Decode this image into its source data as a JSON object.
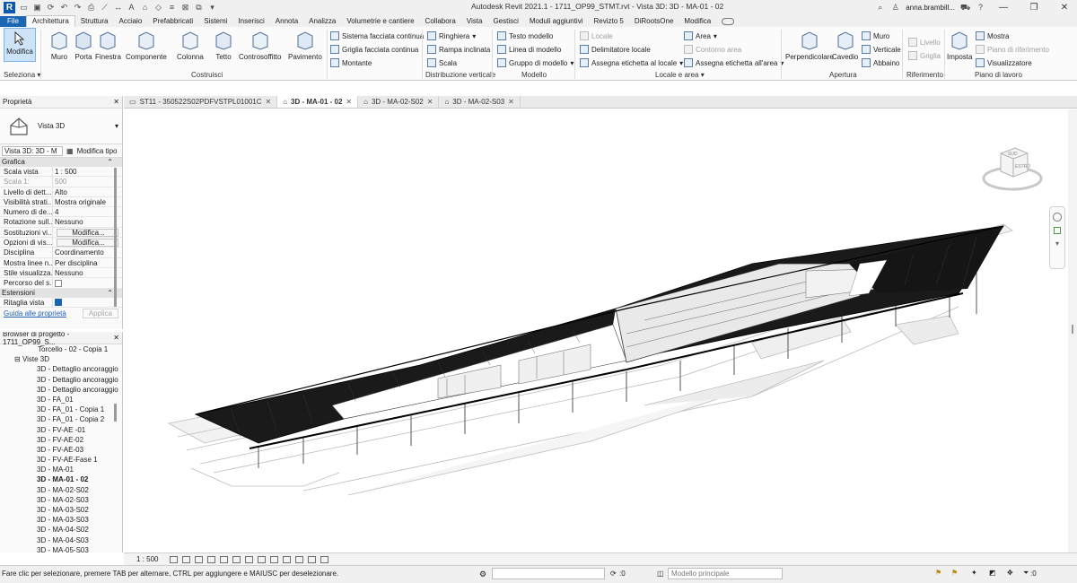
{
  "titlebar": {
    "title": "Autodesk Revit 2021.1 - 1711_OP99_STMT.rvt - Vista 3D: 3D - MA-01 - 02",
    "user": "anna.brambill...",
    "logo_letter": "R",
    "text_tool": "A"
  },
  "ribbon_tabs": [
    "File",
    "Architettura",
    "Struttura",
    "Acciaio",
    "Prefabbricati",
    "Sistemi",
    "Inserisci",
    "Annota",
    "Analizza",
    "Volumetrie e cantiere",
    "Collabora",
    "Vista",
    "Gestisci",
    "Moduli aggiuntivi",
    "Revizto 5",
    "DiRootsOne",
    "Modifica"
  ],
  "ribbon": {
    "modify": "Modifica",
    "build": [
      "Muro",
      "Porta",
      "Finestra",
      "Componente",
      "Colonna",
      "Tetto",
      "Controsoffitto",
      "Pavimento"
    ],
    "curtain": [
      "Sistema facciata continua",
      "Griglia facciata continua",
      "Montante"
    ],
    "circulation": [
      "Ringhiera",
      "Rampa inclinata",
      "Scala"
    ],
    "model": [
      "Testo modello",
      "Linea di modello",
      "Gruppo di modello"
    ],
    "room": [
      "Locale",
      "Delimitatore  locale",
      "Assegna etichetta  al locale"
    ],
    "area": [
      "Area",
      "Contorno  area",
      "Assegna etichetta  all'area"
    ],
    "opening": [
      "Perpendicolare",
      "Cavedio"
    ],
    "opening_small": [
      "Muro",
      "Verticale",
      "Abbaino"
    ],
    "datum": [
      "Livello",
      "Griglia"
    ],
    "workplane_big": "Imposta",
    "workplane": [
      "Mostra",
      "Piano di riferimento",
      "Visualizzatore"
    ],
    "panels": {
      "select": "Seleziona",
      "build": "Costruisci",
      "circulation": "Distribuzione verticale",
      "model": "Modello",
      "room": "Locale e area",
      "opening": "Apertura",
      "datum": "Riferimento",
      "workplane": "Piano di lavoro"
    }
  },
  "properties": {
    "title": "Proprietà",
    "type_name": "Vista 3D",
    "instance": "Vista 3D: 3D - M",
    "edit_type": "Modifica tipo",
    "group_graphics": "Grafica",
    "group_extents": "Estensioni",
    "rows": [
      {
        "k": "Scala vista",
        "v": "1 : 500"
      },
      {
        "k": "Scala  1:",
        "v": "500"
      },
      {
        "k": "Livello di dett...",
        "v": "Alto"
      },
      {
        "k": "Visibilità strati...",
        "v": "Mostra originale"
      },
      {
        "k": "Numero di de...",
        "v": "4"
      },
      {
        "k": "Rotazione sull...",
        "v": "Nessuno"
      },
      {
        "k": "Sostituzioni vi...",
        "v": "Modifica..."
      },
      {
        "k": "Opzioni di vis...",
        "v": "Modifica..."
      },
      {
        "k": "Disciplina",
        "v": "Coordinamento"
      },
      {
        "k": "Mostra linee n...",
        "v": "Per disciplina"
      },
      {
        "k": "Stile visualizza...",
        "v": "Nessuno"
      },
      {
        "k": "Percorso del s...",
        "v": ""
      }
    ],
    "crop": "Ritaglia vista",
    "help": "Guida alle proprietà",
    "apply": "Applica"
  },
  "browser": {
    "title": "Browser di progetto - 1711_OP99_S...",
    "items": [
      {
        "label": "Torcello - 02 - Copia 1",
        "indent": 2
      },
      {
        "label": "Viste 3D",
        "indent": 1
      },
      {
        "label": "3D - Dettaglio ancoraggio",
        "indent": 3
      },
      {
        "label": "3D - Dettaglio ancoraggio",
        "indent": 3
      },
      {
        "label": "3D - Dettaglio ancoraggio",
        "indent": 3
      },
      {
        "label": "3D - FA_01",
        "indent": 3
      },
      {
        "label": "3D - FA_01 - Copia 1",
        "indent": 3
      },
      {
        "label": "3D - FA_01 - Copia 2",
        "indent": 3
      },
      {
        "label": "3D - FV-AE -01",
        "indent": 3
      },
      {
        "label": "3D - FV-AE-02",
        "indent": 3
      },
      {
        "label": "3D - FV-AE-03",
        "indent": 3
      },
      {
        "label": "3D - FV-AE-Fase 1",
        "indent": 3
      },
      {
        "label": "3D - MA-01",
        "indent": 3
      },
      {
        "label": "3D - MA-01 - 02",
        "indent": 3,
        "bold": true
      },
      {
        "label": "3D - MA-02-S02",
        "indent": 3
      },
      {
        "label": "3D - MA-02-S03",
        "indent": 3
      },
      {
        "label": "3D - MA-03-S02",
        "indent": 3
      },
      {
        "label": "3D - MA-03-S03",
        "indent": 3
      },
      {
        "label": "3D - MA-04-S02",
        "indent": 3
      },
      {
        "label": "3D - MA-04-S03",
        "indent": 3
      },
      {
        "label": "3D - MA-05-S03",
        "indent": 3
      }
    ]
  },
  "view_tabs": [
    {
      "label": "ST11 - 350522S02PDFVSTPL01001C",
      "active": false
    },
    {
      "label": "3D - MA-01 - 02",
      "active": true
    },
    {
      "label": "3D - MA-02-S02",
      "active": false
    },
    {
      "label": "3D - MA-02-S03",
      "active": false
    }
  ],
  "viewcube": {
    "face1": "SUD",
    "face2": "ESTRO"
  },
  "view_control": {
    "scale": "1 : 500"
  },
  "status": {
    "text": "Fare clic per selezionare, premere TAB per alternare, CTRL per aggiungere e MAIUSC per deselezionare.",
    "counter": ":0",
    "model": "Modello principale",
    "filter": ":0"
  },
  "colors": {
    "accent": "#1c67b5",
    "ribbon_bg": "#fbfbfb",
    "selected": "#cde3f8"
  }
}
